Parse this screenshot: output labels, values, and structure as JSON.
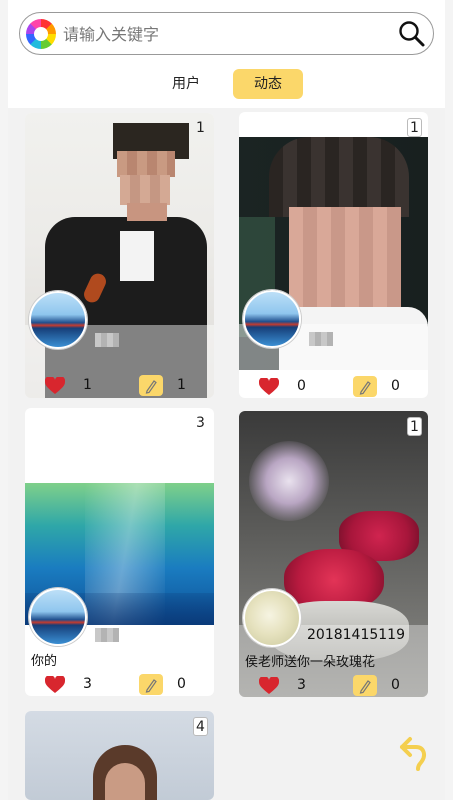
{
  "search": {
    "placeholder": "请输入关键字"
  },
  "tabs": [
    {
      "label": "用户",
      "active": false
    },
    {
      "label": "动态",
      "active": true
    }
  ],
  "accent_color": "#fbd76a",
  "posts": [
    {
      "badge": "1",
      "username": "",
      "caption": "",
      "likes": "1",
      "comments": "1"
    },
    {
      "badge": "1",
      "username": "",
      "caption": "",
      "likes": "0",
      "comments": "0"
    },
    {
      "badge": "3",
      "username": "",
      "caption": "你的",
      "likes": "3",
      "comments": "0"
    },
    {
      "badge": "1",
      "username": "20181415119",
      "caption": "侯老师送你一朵玫瑰花",
      "likes": "3",
      "comments": "0"
    },
    {
      "badge": "4",
      "username": "",
      "caption": "",
      "likes": "",
      "comments": ""
    }
  ],
  "icons": {
    "search": "magnifier-icon",
    "like": "heart-icon",
    "comment": "pencil-icon",
    "back": "return-arrow-icon"
  }
}
